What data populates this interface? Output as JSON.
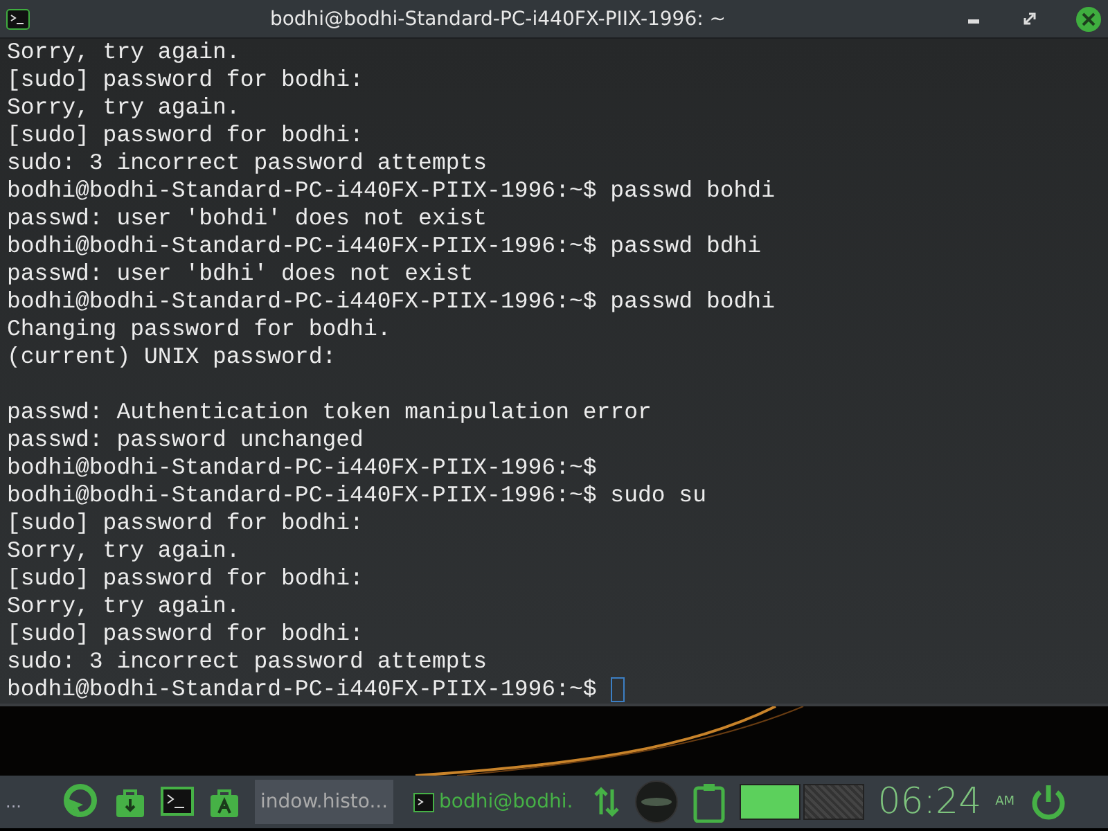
{
  "window": {
    "title": "bodhi@bodhi-Standard-PC-i440FX-PIIX-1996: ~"
  },
  "terminal": {
    "blocks": [
      [
        "Sorry, try again.",
        "[sudo] password for bodhi:",
        "Sorry, try again.",
        "[sudo] password for bodhi:",
        "sudo: 3 incorrect password attempts",
        "bodhi@bodhi-Standard-PC-i440FX-PIIX-1996:~$ passwd bohdi",
        "passwd: user 'bohdi' does not exist",
        "bodhi@bodhi-Standard-PC-i440FX-PIIX-1996:~$ passwd bdhi",
        "passwd: user 'bdhi' does not exist",
        "bodhi@bodhi-Standard-PC-i440FX-PIIX-1996:~$ passwd bodhi",
        "Changing password for bodhi.",
        "(current) UNIX password:"
      ],
      [
        "passwd: Authentication token manipulation error",
        "passwd: password unchanged",
        "bodhi@bodhi-Standard-PC-i440FX-PIIX-1996:~$",
        "bodhi@bodhi-Standard-PC-i440FX-PIIX-1996:~$ sudo su",
        "[sudo] password for bodhi:",
        "Sorry, try again.",
        "[sudo] password for bodhi:",
        "Sorry, try again.",
        "[sudo] password for bodhi:",
        "sudo: 3 incorrect password attempts"
      ]
    ],
    "prompt": "bodhi@bodhi-Standard-PC-i440FX-PIIX-1996:~$"
  },
  "taskbar": {
    "menu": "...",
    "tasks": [
      {
        "label": "indow.histo...",
        "selected": true,
        "kind": "plain"
      },
      {
        "label": "bodhi@bodhi.",
        "selected": false,
        "kind": "terminal"
      }
    ],
    "workspaces": [
      {
        "selected": true
      },
      {
        "selected": false
      }
    ],
    "clock": "06:24",
    "ampm": "AM"
  }
}
